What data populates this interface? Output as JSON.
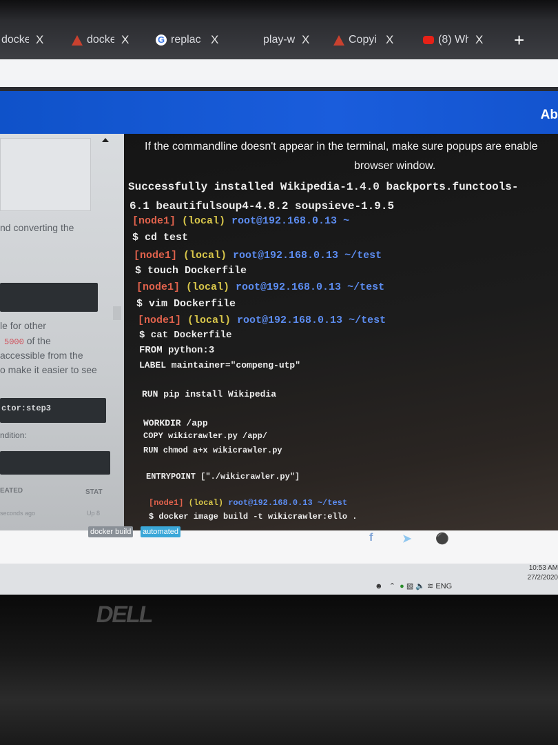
{
  "tabs": [
    {
      "label": "docke",
      "icon": "none"
    },
    {
      "label": "docke",
      "icon": "warning-icon"
    },
    {
      "label": "replac",
      "icon": "google-icon"
    },
    {
      "label": "play-w",
      "icon": "none"
    },
    {
      "label": "Copyi",
      "icon": "warning-icon"
    },
    {
      "label": "(8) Wh",
      "icon": "youtube-icon"
    }
  ],
  "tab_close_glyph": "X",
  "new_tab_glyph": "+",
  "header": {
    "partial_text": "Ab"
  },
  "left_panel": {
    "line1": "nd converting the",
    "line2": "le for other",
    "line3_code": "5000",
    "line3_rest": " of the",
    "line4": "accessible from the",
    "line5": "o make it easier to see",
    "code_box": "ctor:step3",
    "line6": "ndition:",
    "col1": "EATED",
    "col2": "STAT",
    "row1_col1": "seconds ago",
    "row1_col2": "Up 8"
  },
  "terminal": {
    "notice_line1": "If the commandline doesn't appear in the terminal, make sure popups are enable",
    "notice_line2": "browser window.",
    "lines": [
      {
        "type": "out",
        "text": "Successfully installed Wikipedia-1.4.0 backports.functools-"
      },
      {
        "type": "out",
        "text": "6.1 beautifulsoup4-4.8.2 soupsieve-1.9.5"
      },
      {
        "type": "prompt",
        "node": "[node1]",
        "local": "(local)",
        "host": "root@192.168.0.13",
        "dir": "~"
      },
      {
        "type": "out",
        "text": "$ cd test"
      },
      {
        "type": "prompt",
        "node": "[node1]",
        "local": "(local)",
        "host": "root@192.168.0.13",
        "dir": "~/test"
      },
      {
        "type": "out",
        "text": "$ touch Dockerfile"
      },
      {
        "type": "prompt",
        "node": "[node1]",
        "local": "(local)",
        "host": "root@192.168.0.13",
        "dir": "~/test"
      },
      {
        "type": "out",
        "text": "$ vim Dockerfile"
      },
      {
        "type": "prompt",
        "node": "[node1]",
        "local": "(local)",
        "host": "root@192.168.0.13",
        "dir": "~/test"
      },
      {
        "type": "out",
        "text": "$ cat Dockerfile"
      },
      {
        "type": "out",
        "text": "FROM python:3"
      },
      {
        "type": "out",
        "text": "LABEL maintainer=\"compeng-utp\""
      },
      {
        "type": "out",
        "text": "RUN pip install Wikipedia"
      },
      {
        "type": "out",
        "text": "WORKDIR /app"
      },
      {
        "type": "out",
        "text": "COPY wikicrawler.py /app/"
      },
      {
        "type": "out",
        "text": "RUN chmod a+x wikicrawler.py"
      },
      {
        "type": "out",
        "text": "ENTRYPOINT [\"./wikicrawler.py\"]"
      },
      {
        "type": "prompt",
        "node": "[node1]",
        "local": "(local)",
        "host": "root@192.168.0.13",
        "dir": "~/test"
      },
      {
        "type": "out",
        "text": "$ docker image build -t wikicrawler:ello ."
      }
    ]
  },
  "tags": [
    "docker build",
    "automated"
  ],
  "share_icons": [
    "facebook-icon",
    "twitter-icon",
    "pinterest-icon"
  ],
  "taskbar": {
    "language": "ENG",
    "time": "10:53 AM",
    "date": "27/2/2020"
  },
  "bezel_logo": "DELL"
}
